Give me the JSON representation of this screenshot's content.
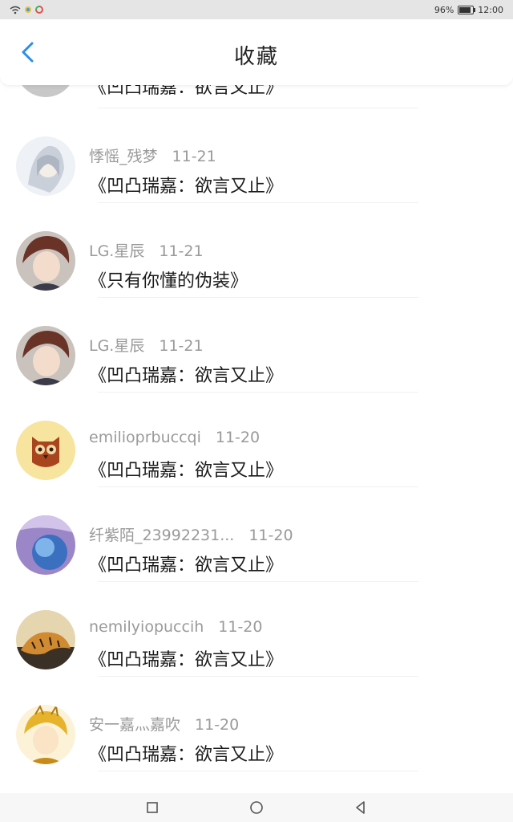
{
  "status_bar": {
    "battery": "96%",
    "time": "12:00"
  },
  "header": {
    "title": "收藏"
  },
  "items": [
    {
      "name": "",
      "date": "",
      "text": "《凹凸瑞嘉：欲言又止》",
      "avatar": "#bdbdbd"
    },
    {
      "name": "悸愮_残梦",
      "date": "11-21",
      "text": "《凹凸瑞嘉：欲言又止》",
      "avatar": "#d7dde6"
    },
    {
      "name": "LG.星辰",
      "date": "11-21",
      "text": "《只有你懂的伪装》",
      "avatar": "#7a4a3a"
    },
    {
      "name": "LG.星辰",
      "date": "11-21",
      "text": "《凹凸瑞嘉：欲言又止》",
      "avatar": "#7a4a3a"
    },
    {
      "name": "emilioprbuccqi",
      "date": "11-20",
      "text": "《凹凸瑞嘉：欲言又止》",
      "avatar": "#f6e39a"
    },
    {
      "name": "纤紫陌_23992231...",
      "date": "11-20",
      "text": "《凹凸瑞嘉：欲言又止》",
      "avatar": "#7f6fb8"
    },
    {
      "name": "nemilyiopuccih",
      "date": "11-20",
      "text": "《凹凸瑞嘉：欲言又止》",
      "avatar": "#b98a3e"
    },
    {
      "name": "安一嘉灬嘉吹",
      "date": "11-20",
      "text": "《凹凸瑞嘉：欲言又止》",
      "avatar": "#e7b83a"
    }
  ]
}
